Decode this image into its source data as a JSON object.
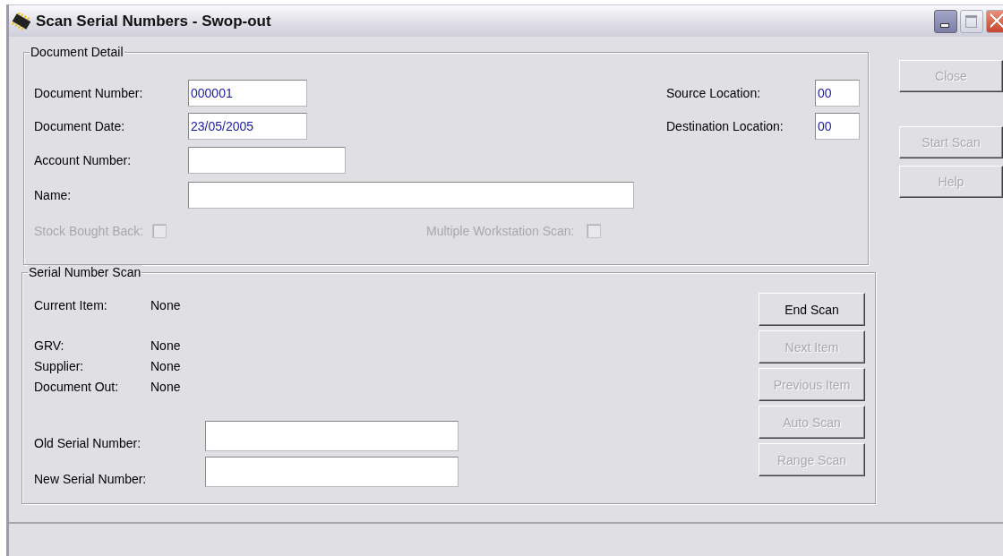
{
  "window": {
    "title": "Scan Serial Numbers - Swop-out",
    "controls": [
      {
        "kind": "minimize"
      },
      {
        "kind": "maximize"
      },
      {
        "kind": "close"
      }
    ]
  },
  "document_detail": {
    "title": "Document Detail",
    "fields": [
      {
        "label": "Document Number:",
        "value": "000001"
      },
      {
        "label": "Document Date:",
        "value": "23/05/2005"
      },
      {
        "label": "Account Number:"
      },
      {
        "label": "Name:"
      }
    ],
    "locations": [
      {
        "label": "Source Location:",
        "value": "00"
      },
      {
        "label": "Destination Location:",
        "value": "00"
      }
    ],
    "checkboxes": [
      {
        "label": "Stock Bought Back:",
        "checked": false,
        "disabled": true
      },
      {
        "label": "Multiple Workstation Scan:",
        "checked": false,
        "disabled": true
      }
    ]
  },
  "serial_number_scan": {
    "title": "Serial Number Scan",
    "info": [
      {
        "label": "Current Item:",
        "value": "None"
      },
      {
        "label": "GRV:",
        "value": "None"
      },
      {
        "label": "Supplier:",
        "value": "None"
      },
      {
        "label": "Document Out:",
        "value": "None"
      }
    ],
    "fields": [
      {
        "label": "Old Serial Number:"
      },
      {
        "label": "New Serial Number:"
      }
    ],
    "buttons": [
      {
        "label": "End Scan",
        "disabled": false
      },
      {
        "label": "Next Item",
        "disabled": true
      },
      {
        "label": "Previous Item",
        "disabled": true
      },
      {
        "label": "Auto Scan",
        "disabled": true
      },
      {
        "label": "Range Scan",
        "disabled": true
      }
    ]
  },
  "side_buttons": [
    {
      "label": "Close",
      "disabled": true
    },
    {
      "label": "Start Scan",
      "disabled": true
    },
    {
      "label": "Help",
      "disabled": true
    }
  ]
}
